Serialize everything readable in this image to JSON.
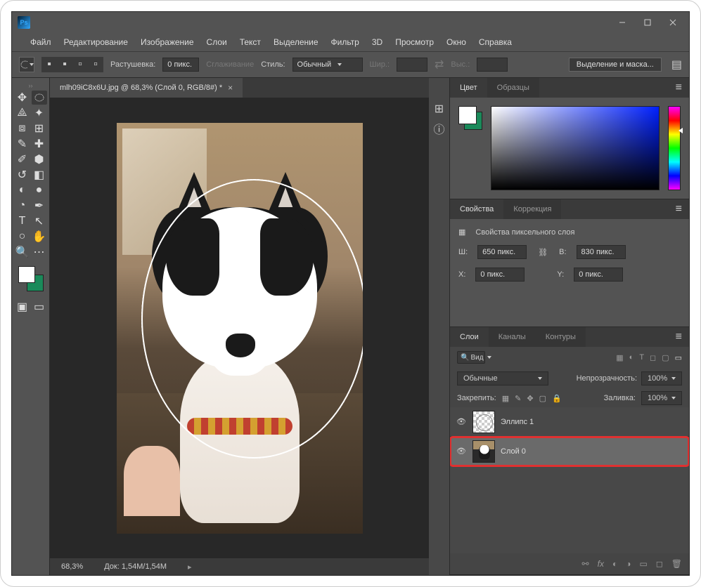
{
  "menubar": [
    "Файл",
    "Редактирование",
    "Изображение",
    "Слои",
    "Текст",
    "Выделение",
    "Фильтр",
    "3D",
    "Просмотр",
    "Окно",
    "Справка"
  ],
  "optionsbar": {
    "feather_label": "Растушевка:",
    "feather_value": "0 пикс.",
    "antialias": "Сглаживание",
    "style_label": "Стиль:",
    "style_value": "Обычный",
    "width_label": "Шир.:",
    "height_label": "Выс.:",
    "select_mask": "Выделение и маска..."
  },
  "tab": {
    "title": "mlh09iC8x6U.jpg @ 68,3% (Слой 0, RGB/8#) *"
  },
  "statusbar": {
    "zoom": "68,3%",
    "docsize": "Док: 1,54M/1,54M"
  },
  "panels": {
    "color": {
      "tab1": "Цвет",
      "tab2": "Образцы"
    },
    "props": {
      "tab1": "Свойства",
      "tab2": "Коррекция",
      "title": "Свойства пиксельного слоя",
      "w_label": "Ш:",
      "w_value": "650 пикс.",
      "h_label": "В:",
      "h_value": "830 пикс.",
      "x_label": "X:",
      "x_value": "0 пикс.",
      "y_label": "Y:",
      "y_value": "0 пикс."
    },
    "layers": {
      "tab1": "Слои",
      "tab2": "Каналы",
      "tab3": "Контуры",
      "search": "Вид",
      "blend": "Обычные",
      "opacity_label": "Непрозрачность:",
      "opacity_value": "100%",
      "lock_label": "Закрепить:",
      "fill_label": "Заливка:",
      "fill_value": "100%",
      "layer1": "Эллипс 1",
      "layer2": "Слой 0"
    }
  }
}
